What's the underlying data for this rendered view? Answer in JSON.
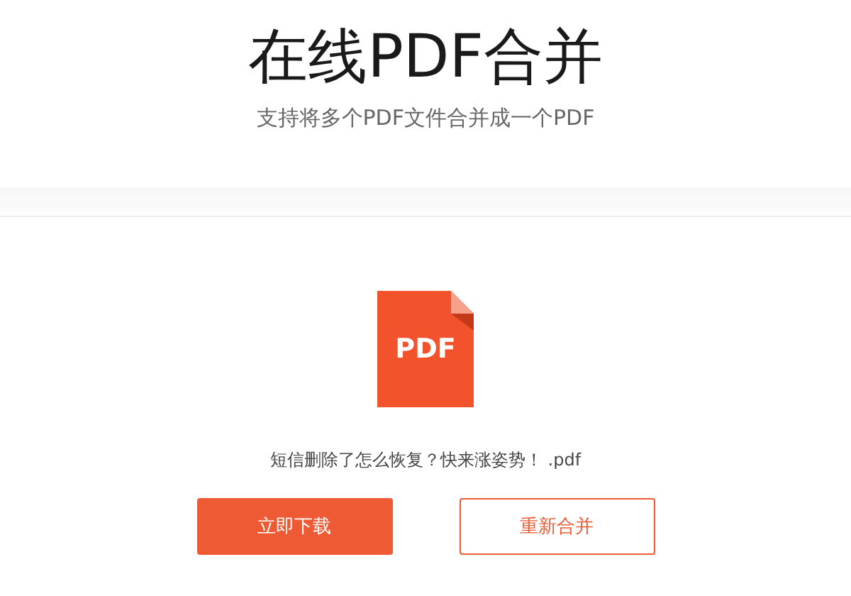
{
  "header": {
    "title": "在线PDF合并",
    "subtitle": "支持将多个PDF文件合并成一个PDF"
  },
  "result": {
    "file_badge": "PDF",
    "file_name": "短信删除了怎么恢复？快来涨姿势！ .pdf"
  },
  "buttons": [
    {
      "label": "立即下载",
      "kind": "primary"
    },
    {
      "label": "重新合并",
      "kind": "outline"
    }
  ]
}
